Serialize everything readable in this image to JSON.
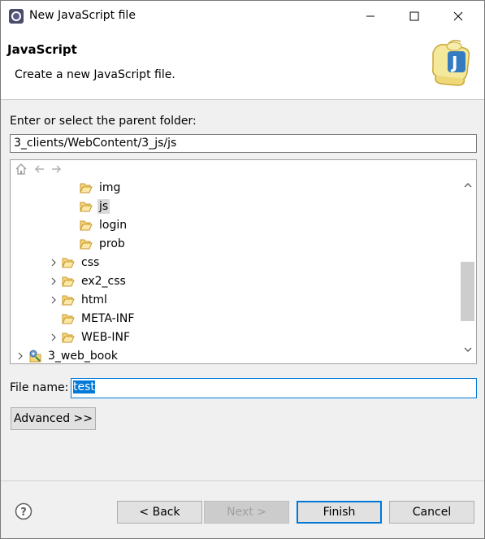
{
  "window": {
    "title": "New JavaScript file"
  },
  "banner": {
    "title": "JavaScript",
    "description": "Create a new JavaScript file."
  },
  "folder": {
    "label": "Enter or select the parent folder:",
    "value": "3_clients/WebContent/3_js/js"
  },
  "tree": {
    "items": [
      {
        "label": "img",
        "expandable": false,
        "selected": false,
        "icon": "folder-open-icon"
      },
      {
        "label": "js",
        "expandable": false,
        "selected": true,
        "icon": "folder-open-icon"
      },
      {
        "label": "login",
        "expandable": false,
        "selected": false,
        "icon": "folder-open-icon"
      },
      {
        "label": "prob",
        "expandable": false,
        "selected": false,
        "icon": "folder-open-icon"
      },
      {
        "label": "css",
        "expandable": true,
        "selected": false,
        "icon": "folder-open-icon"
      },
      {
        "label": "ex2_css",
        "expandable": true,
        "selected": false,
        "icon": "folder-open-icon"
      },
      {
        "label": "html",
        "expandable": true,
        "selected": false,
        "icon": "folder-open-icon"
      },
      {
        "label": "META-INF",
        "expandable": false,
        "selected": false,
        "icon": "folder-open-icon"
      },
      {
        "label": "WEB-INF",
        "expandable": true,
        "selected": false,
        "icon": "folder-open-icon"
      },
      {
        "label": "3_web_book",
        "expandable": true,
        "selected": false,
        "icon": "project-icon"
      }
    ]
  },
  "file": {
    "label": "File name:",
    "value": "test"
  },
  "buttons": {
    "advanced": "Advanced >>",
    "back": "< Back",
    "next": "Next >",
    "finish": "Finish",
    "cancel": "Cancel"
  },
  "colors": {
    "accent": "#0078d7",
    "folder": "#e8b948"
  }
}
